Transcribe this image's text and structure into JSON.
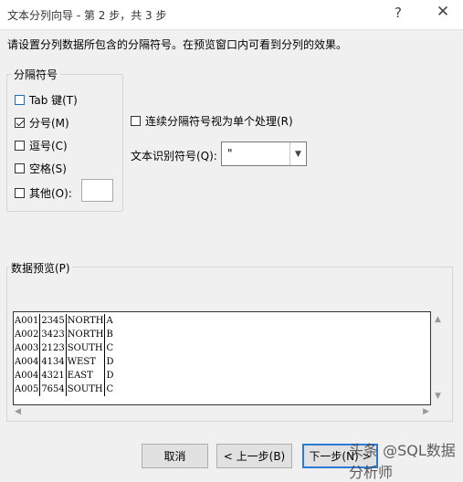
{
  "window": {
    "title": "文本分列向导 - 第 2 步，共 3 步",
    "help": "?",
    "close": "✕"
  },
  "instruction": "请设置分列数据所包含的分隔符号。在预览窗口内可看到分列的效果。",
  "delimiters": {
    "legend": "分隔符号",
    "items": [
      {
        "label": "Tab 键(T)",
        "checked": false
      },
      {
        "label": "分号(M)",
        "checked": true
      },
      {
        "label": "逗号(C)",
        "checked": false
      },
      {
        "label": "空格(S)",
        "checked": false
      },
      {
        "label": "其他(O):",
        "checked": false
      }
    ],
    "other_value": ""
  },
  "consecutive": {
    "label": "连续分隔符号视为单个处理(R)",
    "checked": false
  },
  "qualifier": {
    "label": "文本识别符号(Q):",
    "value": "\""
  },
  "preview": {
    "label": "数据预览(P)",
    "rows": [
      [
        "A001",
        "2345",
        "NORTH",
        "A"
      ],
      [
        "A002",
        "3423",
        "NORTH",
        "B"
      ],
      [
        "A003",
        "2123",
        "SOUTH",
        "C"
      ],
      [
        "A004",
        "4134",
        "WEST",
        "D"
      ],
      [
        "A004",
        "4321",
        "EAST",
        "D"
      ],
      [
        "A005",
        "7654",
        "SOUTH",
        "C"
      ]
    ]
  },
  "buttons": {
    "cancel": "取消",
    "back": "< 上一步(B)",
    "next": "下一步(N) >"
  },
  "watermark": "头条 @SQL数据分析师"
}
